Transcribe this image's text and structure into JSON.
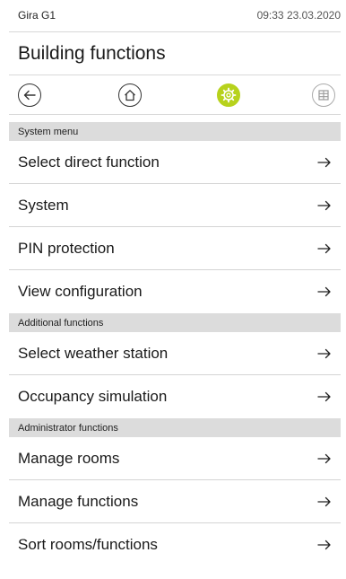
{
  "status": {
    "device": "Gira G1",
    "time_date": "09:33 23.03.2020"
  },
  "page": {
    "title": "Building functions"
  },
  "nav": {
    "back_icon": "arrow-left-icon",
    "home_icon": "home-icon",
    "settings_icon": "gear-icon",
    "grid_icon": "grid-icon",
    "active_color": "#b7d21c"
  },
  "sections": [
    {
      "header": "System menu",
      "items": [
        {
          "label": "Select direct function"
        },
        {
          "label": "System"
        },
        {
          "label": "PIN protection"
        },
        {
          "label": "View configuration"
        }
      ]
    },
    {
      "header": "Additional functions",
      "items": [
        {
          "label": "Select weather station"
        },
        {
          "label": "Occupancy simulation"
        }
      ]
    },
    {
      "header": "Administrator functions",
      "items": [
        {
          "label": "Manage rooms"
        },
        {
          "label": "Manage functions"
        },
        {
          "label": "Sort rooms/functions"
        }
      ]
    }
  ]
}
